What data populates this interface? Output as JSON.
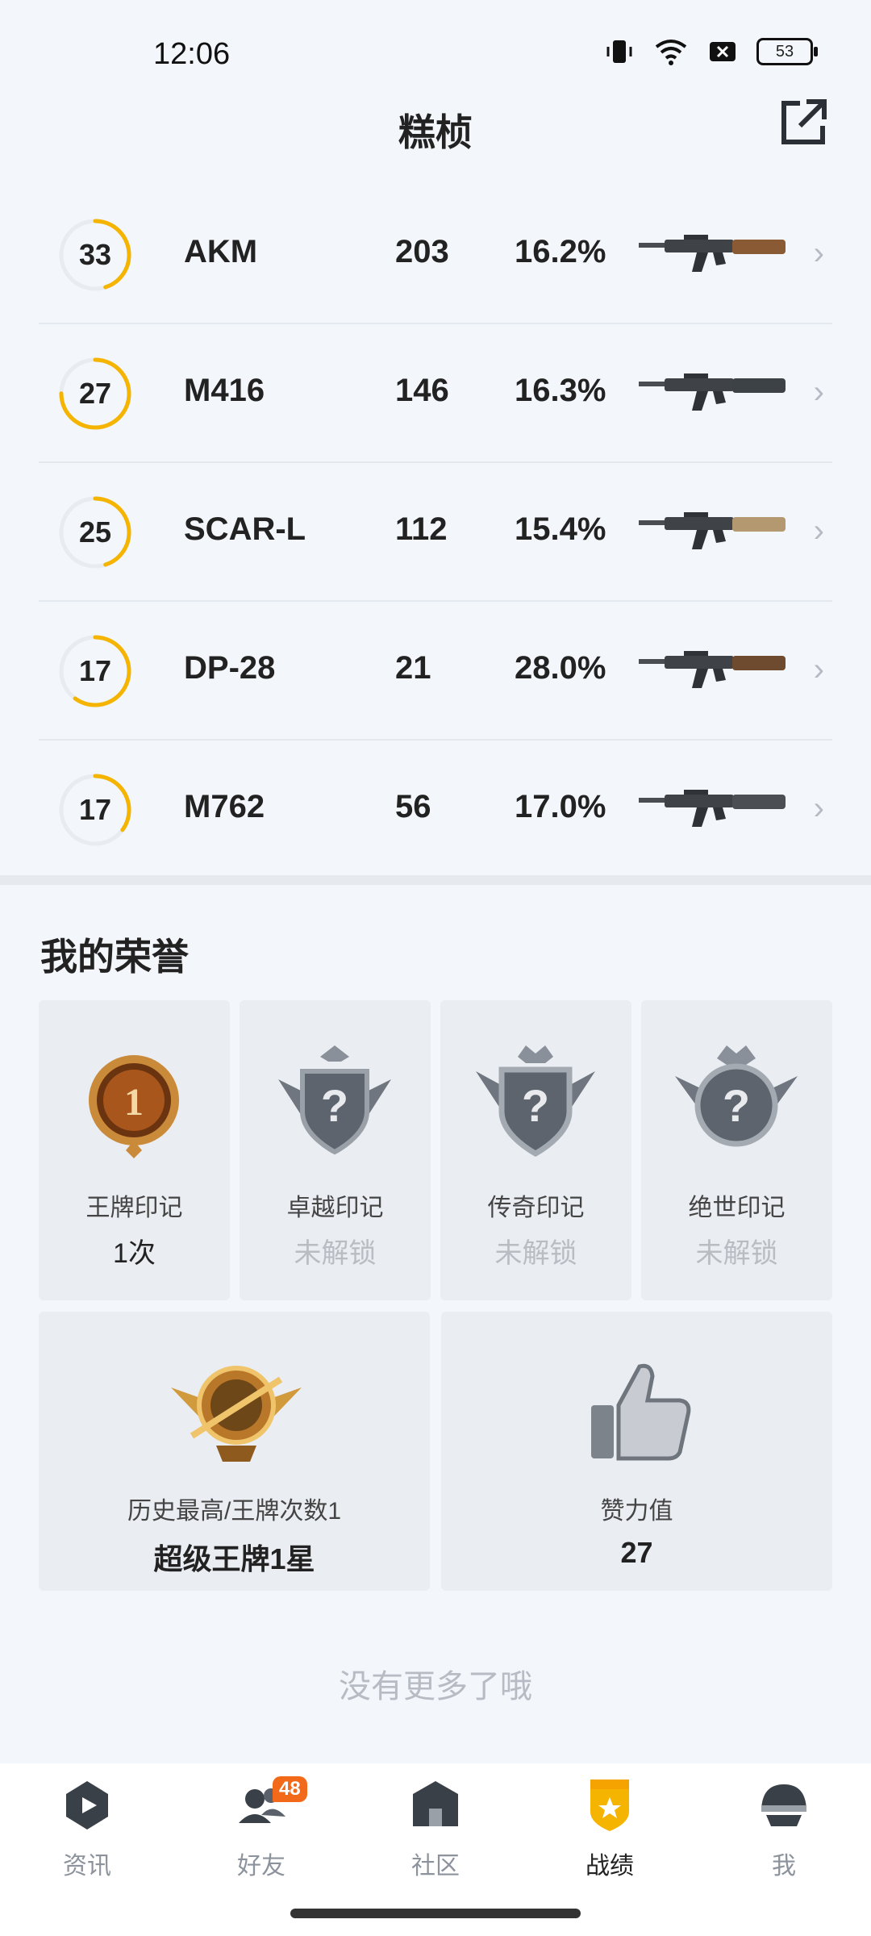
{
  "status_bar": {
    "time": "12:06",
    "battery": "53"
  },
  "header": {
    "title": "糕桢",
    "share_icon": "share-external-icon"
  },
  "weapons": [
    {
      "level": "33",
      "progress": 0.45,
      "name": "AKM",
      "kills": "203",
      "rate": "16.2%",
      "icon": "akm-rifle-image"
    },
    {
      "level": "27",
      "progress": 0.75,
      "name": "M416",
      "kills": "146",
      "rate": "16.3%",
      "icon": "m416-rifle-image"
    },
    {
      "level": "25",
      "progress": 0.45,
      "name": "SCAR-L",
      "kills": "112",
      "rate": "15.4%",
      "icon": "scarl-rifle-image"
    },
    {
      "level": "17",
      "progress": 0.6,
      "name": "DP-28",
      "kills": "21",
      "rate": "28.0%",
      "icon": "dp28-lmg-image"
    },
    {
      "level": "17",
      "progress": 0.35,
      "name": "M762",
      "kills": "56",
      "rate": "17.0%",
      "icon": "m762-rifle-image"
    }
  ],
  "honors": {
    "title": "我的荣誉",
    "badges": [
      {
        "name": "王牌印记",
        "value": "1次",
        "locked": false,
        "icon": "ace-mark-icon",
        "number": "1"
      },
      {
        "name": "卓越印记",
        "value": "未解锁",
        "locked": true,
        "icon": "excellence-mark-locked-icon"
      },
      {
        "name": "传奇印记",
        "value": "未解锁",
        "locked": true,
        "icon": "legend-mark-locked-icon"
      },
      {
        "name": "绝世印记",
        "value": "未解锁",
        "locked": true,
        "icon": "peerless-mark-locked-icon"
      }
    ],
    "highest": {
      "label": "历史最高/王牌次数1",
      "value": "超级王牌1星",
      "icon": "super-ace-rank-icon"
    },
    "likes": {
      "label": "赞力值",
      "value": "27",
      "icon": "thumbs-up-icon"
    }
  },
  "end_text": "没有更多了哦",
  "nav": [
    {
      "label": "资讯",
      "icon": "news-play-icon",
      "active": false
    },
    {
      "label": "好友",
      "icon": "friends-icon",
      "active": false,
      "badge": "48"
    },
    {
      "label": "社区",
      "icon": "community-house-icon",
      "active": false
    },
    {
      "label": "战绩",
      "icon": "record-shield-icon",
      "active": true
    },
    {
      "label": "我",
      "icon": "helmet-profile-icon",
      "active": false
    }
  ],
  "colors": {
    "ring_accent": "#f5b400",
    "ring_track": "#e8ebf0",
    "nav_active": "#f5a300",
    "badge_orange": "#f2691a"
  }
}
